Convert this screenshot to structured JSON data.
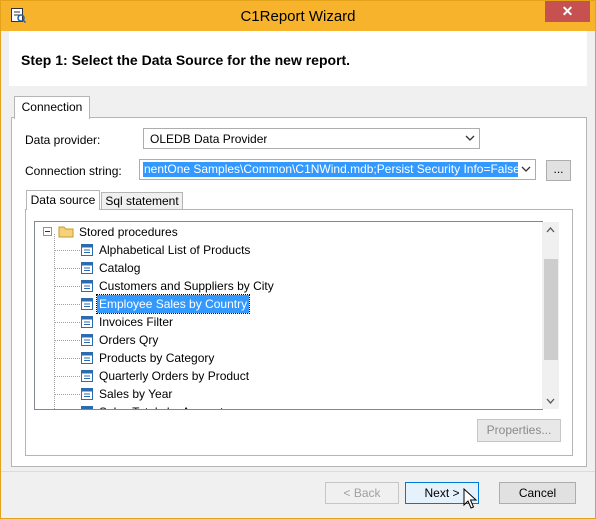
{
  "window": {
    "title": "C1Report Wizard",
    "close_glyph": "✕"
  },
  "header": {
    "step_text": "Step 1: Select the Data Source for the new report."
  },
  "tabs": {
    "connection": "Connection"
  },
  "form": {
    "data_provider_label": "Data provider:",
    "data_provider_value": "OLEDB Data Provider",
    "connection_string_label": "Connection string:",
    "connection_string_value": "nentOne Samples\\Common\\C1NWind.mdb;Persist Security Info=False",
    "browse_label": "..."
  },
  "inner_tabs": {
    "data_source": "Data source",
    "sql_statement": "Sql statement"
  },
  "tree": {
    "root_label": "Stored procedures",
    "items": [
      "Alphabetical List of Products",
      "Catalog",
      "Customers and Suppliers by City",
      "Employee Sales by Country",
      "Invoices Filter",
      "Orders Qry",
      "Products by Category",
      "Quarterly Orders by Product",
      "Sales by Year",
      "Sales Totals by Amount"
    ],
    "selected_index": 3
  },
  "buttons": {
    "properties": "Properties...",
    "back": "< Back",
    "next": "Next >",
    "cancel": "Cancel"
  },
  "colors": {
    "title_bar": "#f6b32b",
    "selection": "#3399ff",
    "close_button": "#c75050"
  }
}
